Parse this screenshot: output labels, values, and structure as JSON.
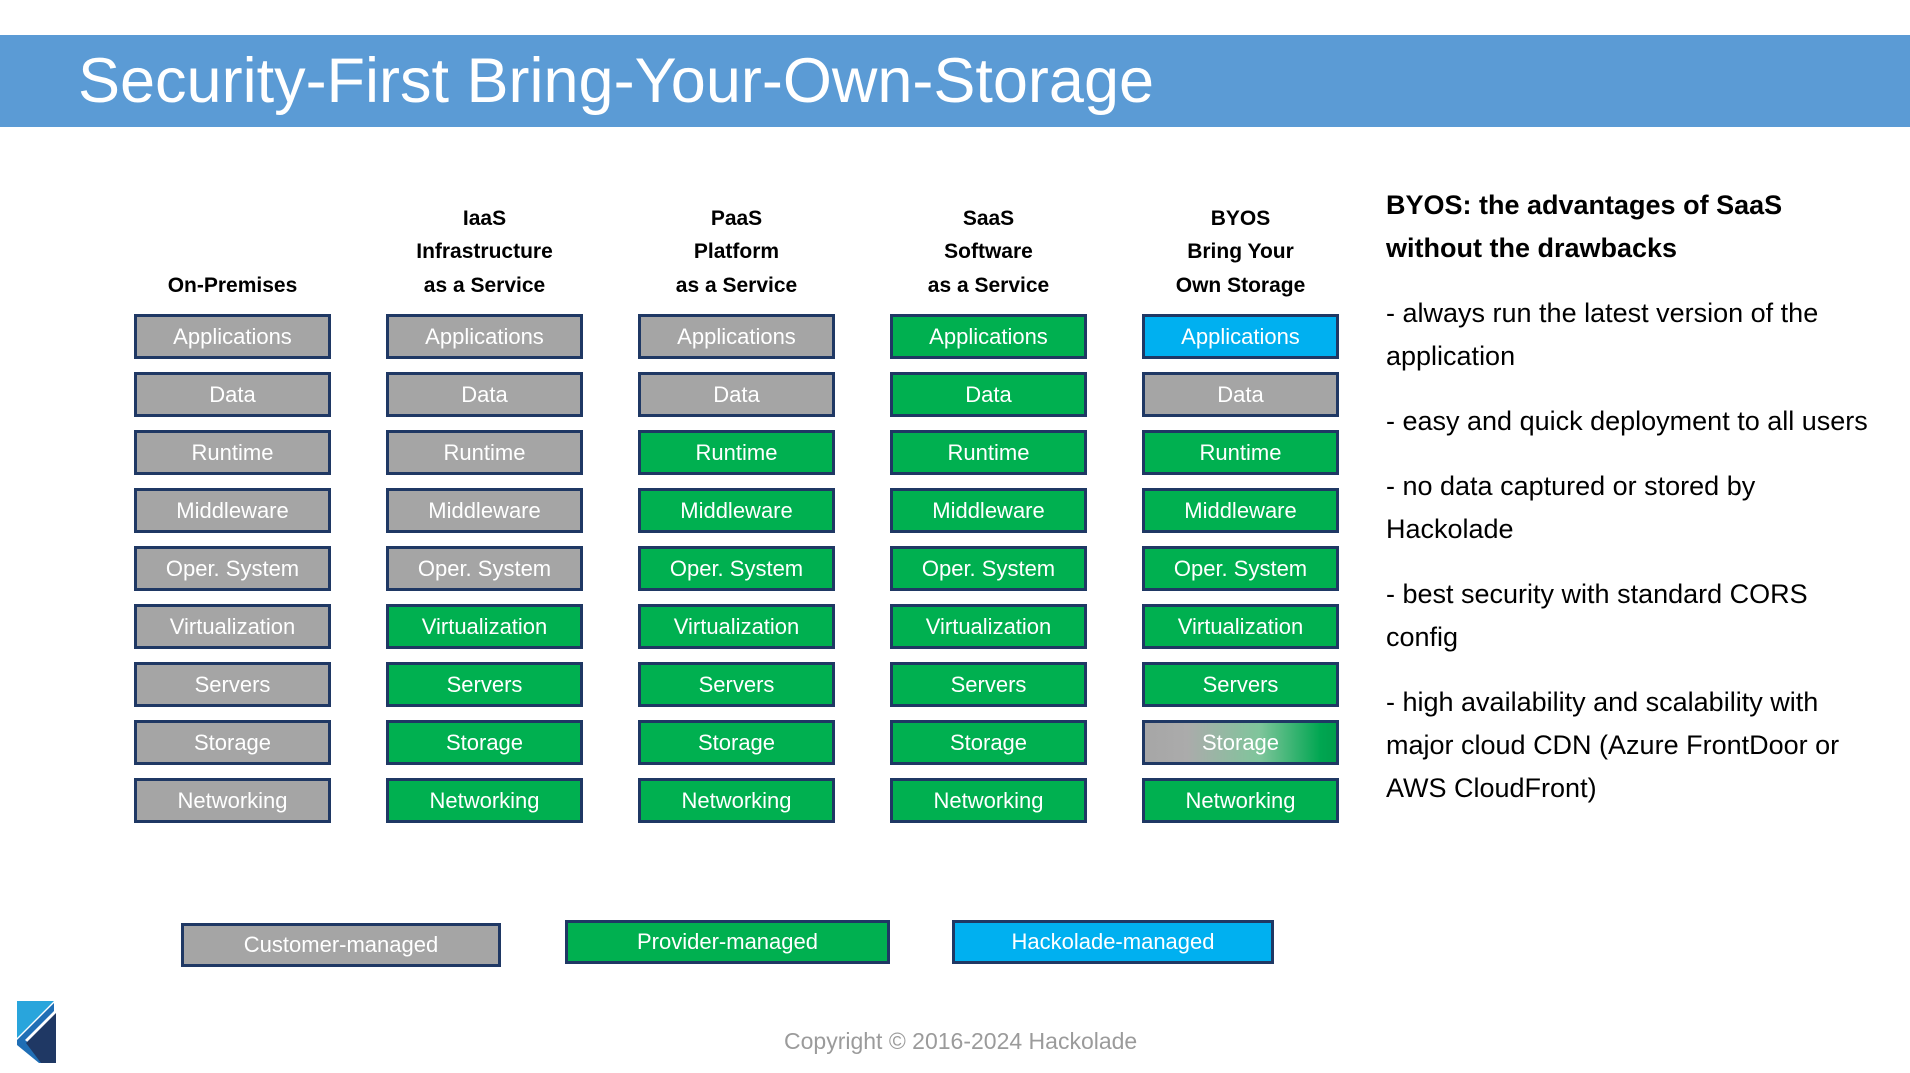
{
  "title": "Security-First Bring-Your-Own-Storage",
  "colors": {
    "title_band": "#5B9BD5",
    "border": "#1F3864",
    "customer_managed": "#A5A5A5",
    "provider_managed": "#00B050",
    "hackolade_managed": "#00B0F0",
    "copyright_text": "#9B9B9B"
  },
  "matrix": {
    "row_labels": [
      "Applications",
      "Data",
      "Runtime",
      "Middleware",
      "Oper. System",
      "Virtualization",
      "Servers",
      "Storage",
      "Networking"
    ],
    "columns": [
      {
        "id": "on-premises",
        "header_lines": [
          "",
          "",
          "On-Premises"
        ],
        "cells": [
          {
            "label": "Applications",
            "fill": "gray"
          },
          {
            "label": "Data",
            "fill": "gray"
          },
          {
            "label": "Runtime",
            "fill": "gray"
          },
          {
            "label": "Middleware",
            "fill": "gray"
          },
          {
            "label": "Oper. System",
            "fill": "gray"
          },
          {
            "label": "Virtualization",
            "fill": "gray"
          },
          {
            "label": "Servers",
            "fill": "gray"
          },
          {
            "label": "Storage",
            "fill": "gray"
          },
          {
            "label": "Networking",
            "fill": "gray"
          }
        ]
      },
      {
        "id": "iaas",
        "header_lines": [
          "IaaS",
          "Infrastructure",
          "as a Service"
        ],
        "cells": [
          {
            "label": "Applications",
            "fill": "gray"
          },
          {
            "label": "Data",
            "fill": "gray"
          },
          {
            "label": "Runtime",
            "fill": "gray"
          },
          {
            "label": "Middleware",
            "fill": "gray"
          },
          {
            "label": "Oper. System",
            "fill": "gray"
          },
          {
            "label": "Virtualization",
            "fill": "green"
          },
          {
            "label": "Servers",
            "fill": "green"
          },
          {
            "label": "Storage",
            "fill": "green"
          },
          {
            "label": "Networking",
            "fill": "green"
          }
        ]
      },
      {
        "id": "paas",
        "header_lines": [
          "PaaS",
          "Platform",
          "as a Service"
        ],
        "cells": [
          {
            "label": "Applications",
            "fill": "gray"
          },
          {
            "label": "Data",
            "fill": "gray"
          },
          {
            "label": "Runtime",
            "fill": "green"
          },
          {
            "label": "Middleware",
            "fill": "green"
          },
          {
            "label": "Oper. System",
            "fill": "green"
          },
          {
            "label": "Virtualization",
            "fill": "green"
          },
          {
            "label": "Servers",
            "fill": "green"
          },
          {
            "label": "Storage",
            "fill": "green"
          },
          {
            "label": "Networking",
            "fill": "green"
          }
        ]
      },
      {
        "id": "saas",
        "header_lines": [
          "SaaS",
          "Software",
          "as a Service"
        ],
        "cells": [
          {
            "label": "Applications",
            "fill": "green"
          },
          {
            "label": "Data",
            "fill": "green"
          },
          {
            "label": "Runtime",
            "fill": "green"
          },
          {
            "label": "Middleware",
            "fill": "green"
          },
          {
            "label": "Oper. System",
            "fill": "green"
          },
          {
            "label": "Virtualization",
            "fill": "green"
          },
          {
            "label": "Servers",
            "fill": "green"
          },
          {
            "label": "Storage",
            "fill": "green"
          },
          {
            "label": "Networking",
            "fill": "green"
          }
        ]
      },
      {
        "id": "byos",
        "header_lines": [
          "BYOS",
          "Bring Your",
          "Own Storage"
        ],
        "cells": [
          {
            "label": "Applications",
            "fill": "blue"
          },
          {
            "label": "Data",
            "fill": "gray"
          },
          {
            "label": "Runtime",
            "fill": "green"
          },
          {
            "label": "Middleware",
            "fill": "green"
          },
          {
            "label": "Oper. System",
            "fill": "green"
          },
          {
            "label": "Virtualization",
            "fill": "green"
          },
          {
            "label": "Servers",
            "fill": "green"
          },
          {
            "label": "Storage",
            "fill": "gradient"
          },
          {
            "label": "Networking",
            "fill": "green"
          }
        ]
      }
    ]
  },
  "legend": {
    "customer": "Customer-managed",
    "provider": "Provider-managed",
    "hackolade": "Hackolade-managed"
  },
  "panel": {
    "heading": "BYOS: the advantages of SaaS without the drawbacks",
    "bullets": [
      "- always run the latest version of the application",
      "- easy and quick deployment to all users",
      "- no data captured or stored by Hackolade",
      "- best security with standard CORS config",
      "- high availability and scalability with major cloud CDN (Azure FrontDoor or AWS CloudFront)"
    ]
  },
  "footer": {
    "copyright": "Copyright © 2016-2024 Hackolade"
  }
}
